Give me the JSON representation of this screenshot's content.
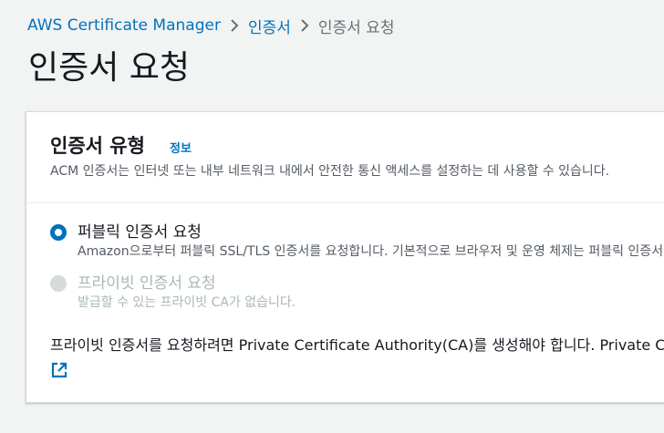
{
  "breadcrumb": {
    "items": [
      "AWS Certificate Manager",
      "인증서",
      "인증서 요청"
    ]
  },
  "page": {
    "title": "인증서 요청"
  },
  "card": {
    "title": "인증서 유형",
    "info_label": "정보",
    "description": "ACM 인증서는 인터넷 또는 내부 네트워크 내에서 안전한 통신 액세스를 설정하는 데 사용할 수 있습니다."
  },
  "options": [
    {
      "label": "퍼블릭 인증서 요청",
      "description": "Amazon으로부터 퍼블릭 SSL/TLS 인증서를 요청합니다. 기본적으로 브라우저 및 운영 체제는 퍼블릭 인증서를 신뢰합니다.",
      "selected": true,
      "disabled": false
    },
    {
      "label": "프라이빗 인증서 요청",
      "description": "발급할 수 있는 프라이빗 CA가 없습니다.",
      "selected": false,
      "disabled": true
    }
  ],
  "note": {
    "text": "프라이빗 인증서를 요청하려면 Private Certificate Authority(CA)를 생성해야 합니다. Private CA 콘솔로 이동"
  },
  "icons": {
    "breadcrumb_separator": "chevron-right-icon",
    "external_link": "external-link-icon"
  },
  "colors": {
    "accent": "#0073bb",
    "background": "#f2f3f3",
    "text": "#16191f",
    "muted": "#545b64",
    "disabled": "#aab7b8"
  }
}
